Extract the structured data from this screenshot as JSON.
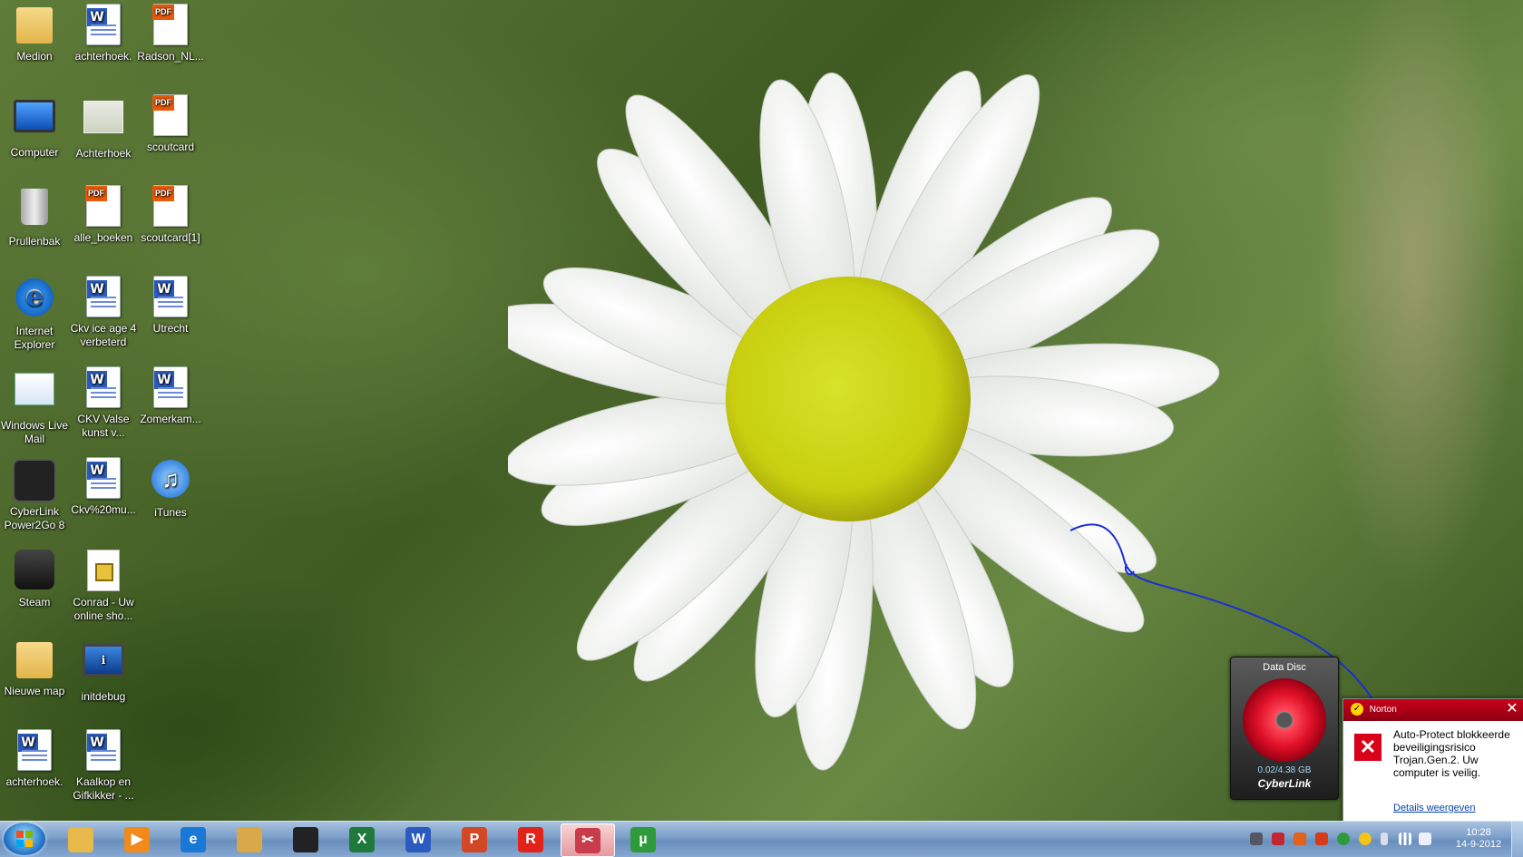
{
  "desktop": {
    "icons": [
      {
        "label": "Medion",
        "icon": "user-folder-icon"
      },
      {
        "label": "achterhoek.",
        "icon": "word-doc-icon"
      },
      {
        "label": "Radson_NL...",
        "icon": "pdf-icon"
      },
      {
        "label": "Computer",
        "icon": "computer-icon"
      },
      {
        "label": "Achterhoek",
        "icon": "image-icon"
      },
      {
        "label": "scoutcard",
        "icon": "pdf-icon"
      },
      {
        "label": "Prullenbak",
        "icon": "recycle-bin-icon"
      },
      {
        "label": "alle_boeken",
        "icon": "pdf-icon"
      },
      {
        "label": "scoutcard[1]",
        "icon": "pdf-icon"
      },
      {
        "label": "Internet Explorer",
        "icon": "internet-explorer-icon"
      },
      {
        "label": "Ckv ice age 4 verbeterd",
        "icon": "word-doc-icon"
      },
      {
        "label": "Utrecht",
        "icon": "word-doc-icon"
      },
      {
        "label": "Windows Live Mail",
        "icon": "windows-live-mail-icon"
      },
      {
        "label": "CKV Valse kunst v...",
        "icon": "word-doc-icon"
      },
      {
        "label": "Zomerkam...",
        "icon": "word-doc-icon"
      },
      {
        "label": "CyberLink Power2Go 8",
        "icon": "cyberlink-power2go-icon"
      },
      {
        "label": "Ckv%20mu...",
        "icon": "word-doc-icon"
      },
      {
        "label": "iTunes",
        "icon": "itunes-icon"
      },
      {
        "label": "Steam",
        "icon": "steam-icon"
      },
      {
        "label": "Conrad - Uw online sho...",
        "icon": "web-shortcut-icon"
      },
      {
        "label": "Nieuwe map",
        "icon": "folder-icon"
      },
      {
        "label": "initdebug",
        "icon": "info-icon"
      },
      {
        "label": "achterhoek.",
        "icon": "word-doc-icon"
      },
      {
        "label": "Kaalkop en Gifkikker - ...",
        "icon": "word-doc-icon"
      }
    ]
  },
  "datadisc": {
    "title": "Data Disc",
    "usage": "0.02/4.38 GB",
    "brand": "CyberLink"
  },
  "norton": {
    "brand": "Norton",
    "message": "Auto-Protect blokkeerde beveiligingsrisico Trojan.Gen.2. Uw computer is veilig.",
    "link": "Details weergeven"
  },
  "taskbar": {
    "apps": [
      {
        "name": "windows-explorer-icon",
        "color": "#e7b84a",
        "glyph": ""
      },
      {
        "name": "media-player-icon",
        "color": "#f08a1a",
        "glyph": "▶"
      },
      {
        "name": "internet-explorer-icon",
        "color": "#1a78d6",
        "glyph": "e"
      },
      {
        "name": "windows-live-mail-icon",
        "color": "#d8a849",
        "glyph": ""
      },
      {
        "name": "steam-icon",
        "color": "#222222",
        "glyph": ""
      },
      {
        "name": "excel-icon",
        "color": "#1d7a3a",
        "glyph": "X"
      },
      {
        "name": "word-icon",
        "color": "#2b5bbf",
        "glyph": "W"
      },
      {
        "name": "powerpoint-icon",
        "color": "#d24726",
        "glyph": "P"
      },
      {
        "name": "roblox-icon",
        "color": "#e2231a",
        "glyph": "R"
      },
      {
        "name": "snipping-tool-icon",
        "color": "#c83c4b",
        "glyph": "✂"
      },
      {
        "name": "utorrent-icon",
        "color": "#2f9a3b",
        "glyph": "µ"
      }
    ],
    "clock_time": "10:28",
    "clock_date": "14-9-2012"
  }
}
